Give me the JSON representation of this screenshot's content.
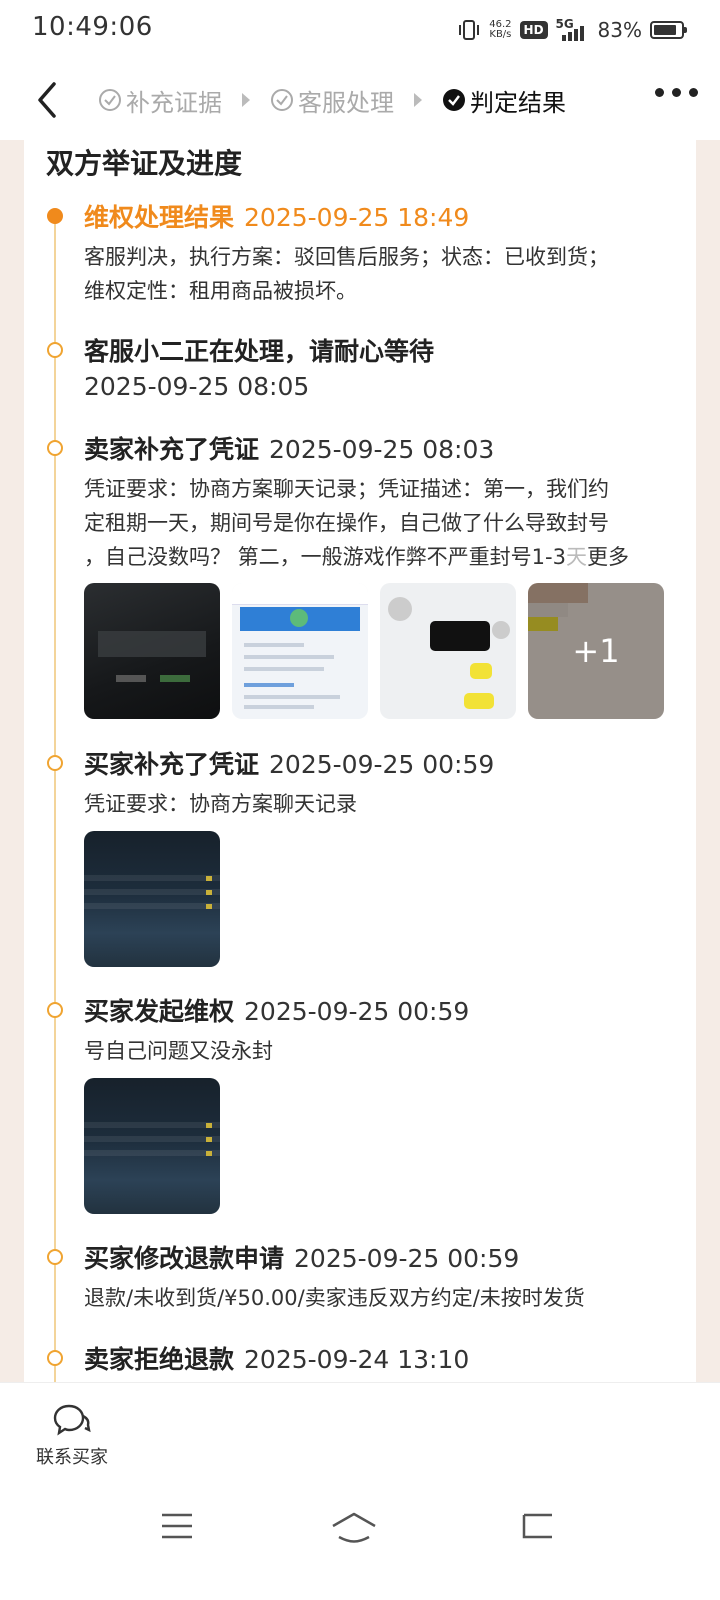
{
  "status_bar": {
    "time": "10:49:06",
    "net_speed_value": "46.2",
    "net_speed_unit": "KB/s",
    "hd_label": "HD",
    "signal_label": "5G",
    "battery_percent": "83%",
    "battery_level": 0.83
  },
  "nav": {
    "steps": [
      {
        "label": "补充证据",
        "state": "done"
      },
      {
        "label": "客服处理",
        "state": "done"
      },
      {
        "label": "判定结果",
        "state": "active"
      }
    ]
  },
  "section": {
    "title": "双方举证及进度"
  },
  "events": [
    {
      "title": "维权处理结果",
      "time": "2025-09-25 18:49",
      "body_lines": [
        "客服判决，执行方案：驳回售后服务；状态：已收到货；",
        "维权定性：租用商品被损坏。"
      ]
    },
    {
      "title": "客服小二正在处理，请耐心等待",
      "time": "2025-09-25 08:05"
    },
    {
      "title": "卖家补充了凭证",
      "time": "2025-09-25 08:03",
      "body_lines": [
        "凭证要求：协商方案聊天记录；凭证描述：第一，我们约",
        "定租期一天，期间号是你在操作，自己做了什么导致封号",
        "，自己没数吗？ 第二，一般游戏作弊不严重封号1-3"
      ],
      "more_label": "更多",
      "overflow_text": "天",
      "more_images_badge": "+1"
    },
    {
      "title": "买家补充了凭证",
      "time": "2025-09-25 00:59",
      "body_lines": [
        "凭证要求：协商方案聊天记录"
      ]
    },
    {
      "title": "买家发起维权",
      "time": "2025-09-25 00:59",
      "body_lines": [
        "号自己问题又没永封"
      ]
    },
    {
      "title": "买家修改退款申请",
      "time": "2025-09-25 00:59",
      "body_lines": [
        "退款/未收到货/¥50.00/卖家违反双方约定/未按时发货"
      ]
    },
    {
      "title": "卖家拒绝退款",
      "time": "2025-09-24 13:10"
    }
  ],
  "bottom": {
    "contact_label": "联系买家"
  },
  "colors": {
    "accent": "#f08a1c",
    "timeline": "#f3d49a",
    "page_bg": "#f5ece6"
  }
}
